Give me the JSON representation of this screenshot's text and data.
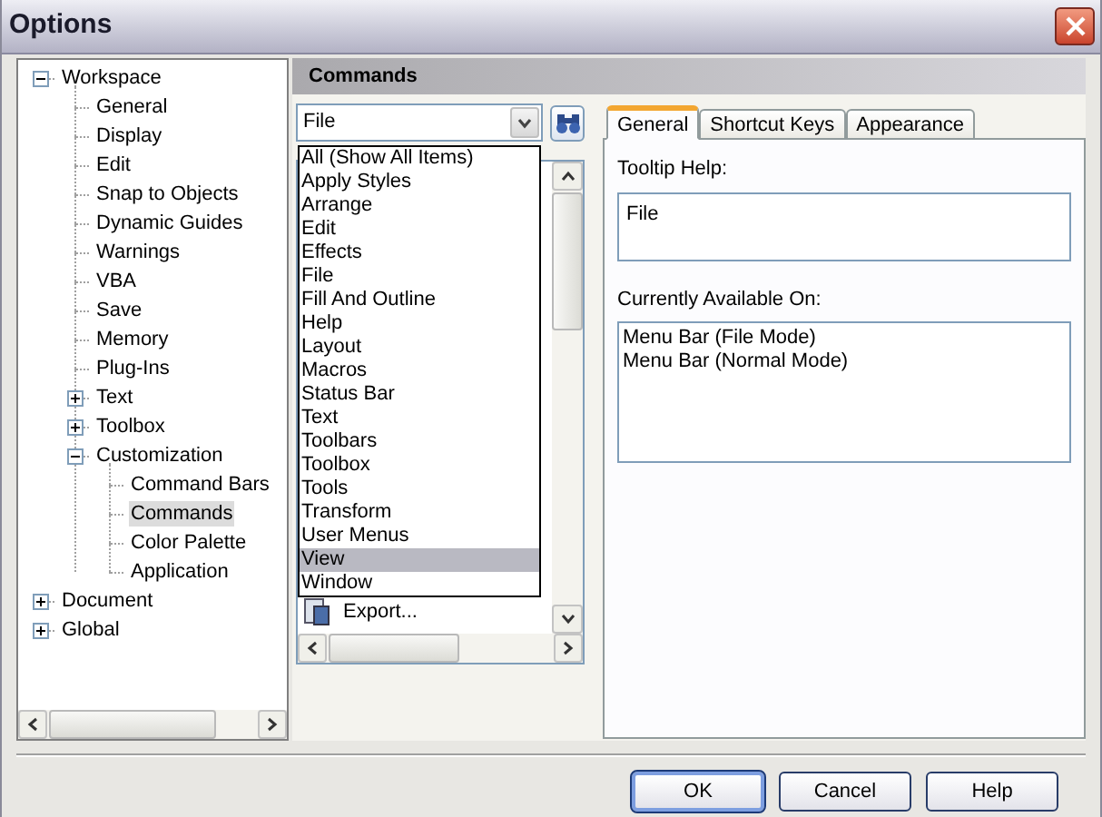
{
  "window": {
    "title": "Options"
  },
  "tree": [
    {
      "label": "Workspace",
      "kind": "folder",
      "expanded": true,
      "selected": false,
      "children": [
        {
          "label": "General",
          "kind": "page",
          "selected": false
        },
        {
          "label": "Display",
          "kind": "page",
          "selected": false
        },
        {
          "label": "Edit",
          "kind": "page",
          "selected": false
        },
        {
          "label": "Snap to Objects",
          "kind": "page",
          "selected": false
        },
        {
          "label": "Dynamic Guides",
          "kind": "page",
          "selected": false
        },
        {
          "label": "Warnings",
          "kind": "page",
          "selected": false
        },
        {
          "label": "VBA",
          "kind": "page",
          "selected": false
        },
        {
          "label": "Save",
          "kind": "page",
          "selected": false
        },
        {
          "label": "Memory",
          "kind": "page",
          "selected": false
        },
        {
          "label": "Plug-Ins",
          "kind": "page",
          "selected": false
        },
        {
          "label": "Text",
          "kind": "folder",
          "expanded": false,
          "selected": false
        },
        {
          "label": "Toolbox",
          "kind": "folder",
          "expanded": false,
          "selected": false
        },
        {
          "label": "Customization",
          "kind": "folder",
          "expanded": true,
          "selected": false,
          "children": [
            {
              "label": "Command Bars",
              "kind": "page",
              "selected": false
            },
            {
              "label": "Commands",
              "kind": "page",
              "selected": true
            },
            {
              "label": "Color Palette",
              "kind": "page",
              "selected": false
            },
            {
              "label": "Application",
              "kind": "page",
              "selected": false
            }
          ]
        }
      ]
    },
    {
      "label": "Document",
      "kind": "folder",
      "expanded": false,
      "selected": false
    },
    {
      "label": "Global",
      "kind": "folder",
      "expanded": false,
      "selected": false
    }
  ],
  "section_header": "Commands",
  "category_combo": {
    "value": "File"
  },
  "category_dropdown": [
    {
      "label": "All (Show All Items)",
      "selected": false
    },
    {
      "label": "Apply Styles",
      "selected": false
    },
    {
      "label": "Arrange",
      "selected": false
    },
    {
      "label": "Edit",
      "selected": false
    },
    {
      "label": "Effects",
      "selected": false
    },
    {
      "label": "File",
      "selected": false
    },
    {
      "label": "Fill And Outline",
      "selected": false
    },
    {
      "label": "Help",
      "selected": false
    },
    {
      "label": "Layout",
      "selected": false
    },
    {
      "label": "Macros",
      "selected": false
    },
    {
      "label": "Status Bar",
      "selected": false
    },
    {
      "label": "Text",
      "selected": false
    },
    {
      "label": "Toolbars",
      "selected": false
    },
    {
      "label": "Toolbox",
      "selected": false
    },
    {
      "label": "Tools",
      "selected": false
    },
    {
      "label": "Transform",
      "selected": false
    },
    {
      "label": "User Menus",
      "selected": false
    },
    {
      "label": "View",
      "selected": true
    },
    {
      "label": "Window",
      "selected": false
    }
  ],
  "command_list": [
    {
      "label": "Export..."
    }
  ],
  "tabs": [
    {
      "label": "General",
      "selected": true
    },
    {
      "label": "Shortcut Keys",
      "selected": false
    },
    {
      "label": "Appearance",
      "selected": false
    }
  ],
  "tooltip_help": {
    "label": "Tooltip Help:",
    "value": "File"
  },
  "available_on": {
    "label": "Currently Available On:",
    "items": [
      "Menu Bar (File Mode)",
      "Menu Bar (Normal Mode)"
    ]
  },
  "buttons": [
    {
      "label": "OK",
      "default": true
    },
    {
      "label": "Cancel",
      "default": false
    },
    {
      "label": "Help",
      "default": false
    }
  ]
}
